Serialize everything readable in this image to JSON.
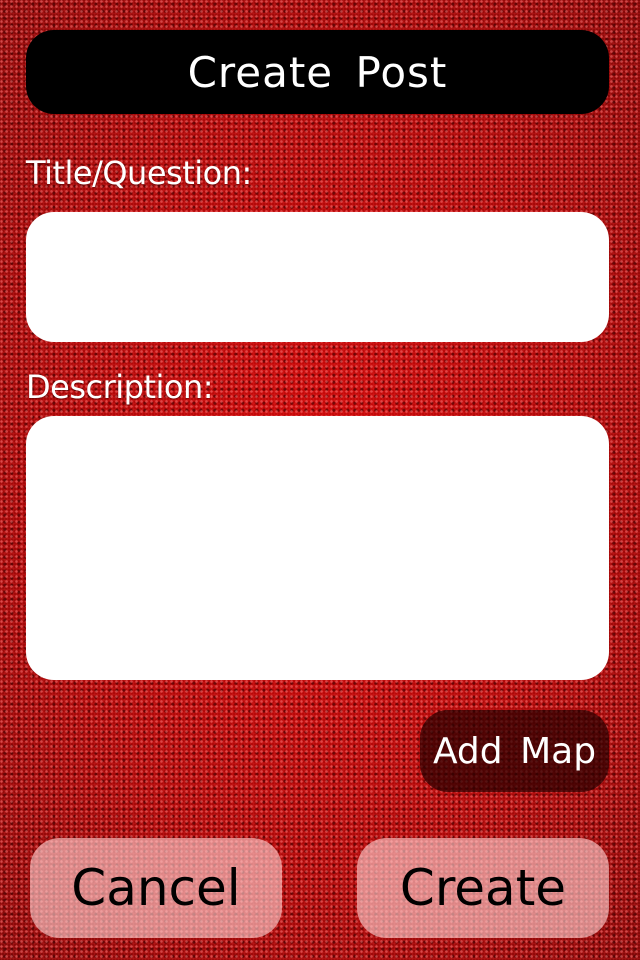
{
  "header": {
    "title": "Create Post"
  },
  "form": {
    "title_label": "Title/Question:",
    "title_value": "",
    "description_label": "Description:",
    "description_value": ""
  },
  "actions": {
    "add_map_label": "Add Map",
    "cancel_label": "Cancel",
    "create_label": "Create"
  },
  "colors": {
    "background": "#a80000",
    "header_bg": "#000000",
    "input_bg": "#ffffff",
    "button_bg": "#f2c8c8"
  }
}
